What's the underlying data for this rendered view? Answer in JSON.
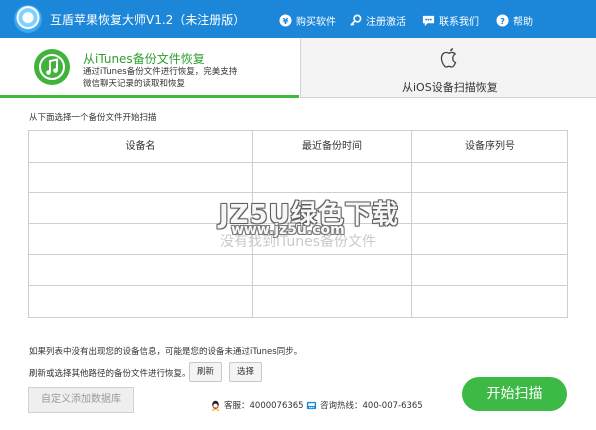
{
  "titlebar": {
    "title": "互盾苹果恢复大师V1.2（未注册版）",
    "buy_label": "购买软件",
    "register_label": "注册激活",
    "contact_label": "联系我们",
    "help_label": "帮助"
  },
  "tabs": {
    "itunes": {
      "title": "从iTunes备份文件恢复",
      "desc": "通过iTunes备份文件进行恢复，完美支持微信聊天记录的读取和恢复",
      "icon": "itunes-music-note-icon"
    },
    "ios": {
      "title": "从iOS设备扫描恢复",
      "icon": "apple-icon"
    }
  },
  "main": {
    "instruction": "从下面选择一个备份文件开始扫描",
    "table": {
      "headers": [
        "设备名",
        "最近备份时间",
        "设备序列号"
      ],
      "empty_message": "没有找到iTunes备份文件"
    },
    "hint_not_found": "如果列表中没有出现您的设备信息，可能是您的设备未通过iTunes同步。",
    "hint_refresh": "刷新或选择其他路径的备份文件进行恢复。",
    "refresh_label": "刷新",
    "select_label": "选择",
    "add_db_label": "自定义添加数据库",
    "qq_support": "客服：4000076365",
    "phone_support": "咨询热线：400-007-6365",
    "start_label": "开始扫描"
  },
  "watermark": {
    "line1": "JZ5U绿色下载",
    "line2": "www.jz5u.com"
  },
  "colors": {
    "titlebar": "#1c87d8",
    "accent_green": "#3dba45",
    "tab_title_green": "#2e9e2e"
  }
}
